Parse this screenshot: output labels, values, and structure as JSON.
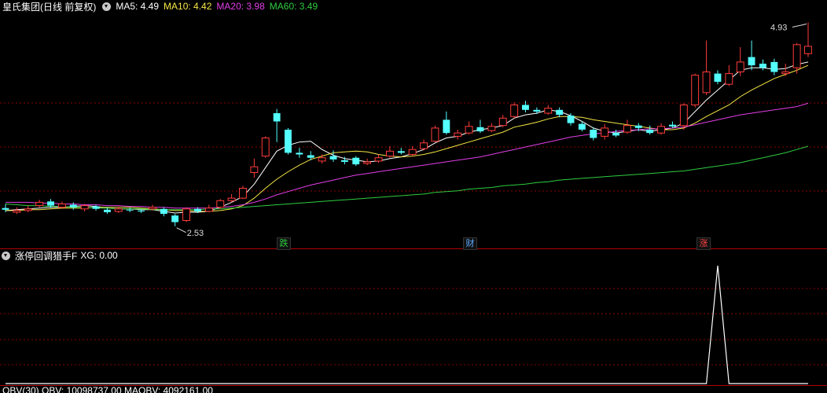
{
  "main_header": {
    "title": "皇氏集团(日线 前复权)",
    "ma5": "MA5: 4.49",
    "ma10": "MA10: 4.42",
    "ma20": "MA20: 3.98",
    "ma60": "MA60: 3.49",
    "colors": {
      "title": "#ffffff",
      "ma5": "#ffffff",
      "ma10": "#f5e645",
      "ma20": "#e23ee8",
      "ma60": "#2ecc40"
    }
  },
  "sub_header": {
    "title": "涨停回调猎手F",
    "xg": "XG: 0.00"
  },
  "bottom_header": {
    "text": "OBV(30)  OBV: 10098737.00  MAOBV: 4092161.00"
  },
  "markers": {
    "high_label": "4.93",
    "low_label": "2.53",
    "tags": [
      {
        "text": "跌",
        "color": "#2ecc40"
      },
      {
        "text": "财",
        "color": "#5aa9ff"
      },
      {
        "text": "涨",
        "color": "#ff4444"
      }
    ]
  },
  "chart_data": {
    "type": "candlestick",
    "ylim": [
      2.3,
      5.1
    ],
    "up_color": "#ff3b3b",
    "down_color": "#54ffff",
    "candles": [
      [
        2.75,
        2.73,
        2.8,
        2.7
      ],
      [
        2.7,
        2.72,
        2.76,
        2.68
      ],
      [
        2.72,
        2.74,
        2.78,
        2.7
      ],
      [
        2.78,
        2.82,
        2.85,
        2.76
      ],
      [
        2.83,
        2.78,
        2.86,
        2.75
      ],
      [
        2.76,
        2.8,
        2.83,
        2.74
      ],
      [
        2.79,
        2.76,
        2.82,
        2.73
      ],
      [
        2.74,
        2.78,
        2.8,
        2.71
      ],
      [
        2.77,
        2.74,
        2.79,
        2.72
      ],
      [
        2.73,
        2.7,
        2.76,
        2.68
      ],
      [
        2.71,
        2.74,
        2.77,
        2.69
      ],
      [
        2.73,
        2.72,
        2.76,
        2.7
      ],
      [
        2.72,
        2.71,
        2.74,
        2.69
      ],
      [
        2.74,
        2.76,
        2.79,
        2.72
      ],
      [
        2.74,
        2.68,
        2.76,
        2.65
      ],
      [
        2.66,
        2.58,
        2.68,
        2.53
      ],
      [
        2.6,
        2.74,
        2.76,
        2.58
      ],
      [
        2.74,
        2.71,
        2.76,
        2.69
      ],
      [
        2.71,
        2.75,
        2.79,
        2.7
      ],
      [
        2.76,
        2.84,
        2.86,
        2.74
      ],
      [
        2.84,
        2.87,
        2.92,
        2.82
      ],
      [
        2.87,
        2.99,
        3.02,
        2.86
      ],
      [
        3.18,
        3.25,
        3.35,
        3.12
      ],
      [
        3.38,
        3.6,
        3.62,
        3.36
      ],
      [
        3.9,
        3.8,
        3.95,
        3.55
      ],
      [
        3.7,
        3.42,
        3.72,
        3.4
      ],
      [
        3.42,
        3.4,
        3.48,
        3.36
      ],
      [
        3.39,
        3.36,
        3.44,
        3.33
      ],
      [
        3.32,
        3.36,
        3.4,
        3.29
      ],
      [
        3.38,
        3.34,
        3.45,
        3.31
      ],
      [
        3.33,
        3.31,
        3.37,
        3.28
      ],
      [
        3.36,
        3.28,
        3.38,
        3.26
      ],
      [
        3.29,
        3.31,
        3.35,
        3.27
      ],
      [
        3.32,
        3.36,
        3.4,
        3.3
      ],
      [
        3.38,
        3.44,
        3.5,
        3.36
      ],
      [
        3.44,
        3.42,
        3.48,
        3.4
      ],
      [
        3.4,
        3.46,
        3.5,
        3.38
      ],
      [
        3.47,
        3.54,
        3.58,
        3.45
      ],
      [
        3.56,
        3.72,
        3.75,
        3.55
      ],
      [
        3.82,
        3.66,
        3.92,
        3.64
      ],
      [
        3.62,
        3.66,
        3.7,
        3.58
      ],
      [
        3.66,
        3.74,
        3.8,
        3.64
      ],
      [
        3.73,
        3.68,
        3.82,
        3.66
      ],
      [
        3.69,
        3.74,
        3.78,
        3.67
      ],
      [
        3.75,
        3.84,
        3.88,
        3.73
      ],
      [
        3.86,
        4.0,
        4.03,
        3.84
      ],
      [
        4.0,
        3.94,
        4.05,
        3.91
      ],
      [
        3.94,
        3.92,
        3.97,
        3.89
      ],
      [
        3.9,
        3.96,
        4.0,
        3.88
      ],
      [
        3.94,
        3.88,
        3.97,
        3.85
      ],
      [
        3.87,
        3.78,
        3.9,
        3.75
      ],
      [
        3.77,
        3.7,
        3.8,
        3.68
      ],
      [
        3.7,
        3.6,
        3.73,
        3.57
      ],
      [
        3.62,
        3.72,
        3.77,
        3.58
      ],
      [
        3.66,
        3.63,
        3.7,
        3.61
      ],
      [
        3.67,
        3.75,
        3.82,
        3.65
      ],
      [
        3.75,
        3.72,
        3.78,
        3.68
      ],
      [
        3.7,
        3.66,
        3.75,
        3.64
      ],
      [
        3.66,
        3.74,
        3.78,
        3.64
      ],
      [
        3.76,
        3.74,
        3.8,
        3.72
      ],
      [
        3.75,
        4.0,
        4.02,
        3.7
      ],
      [
        4.0,
        4.36,
        4.38,
        3.97
      ],
      [
        4.15,
        4.4,
        4.78,
        4.12
      ],
      [
        4.38,
        4.28,
        4.42,
        4.25
      ],
      [
        4.25,
        4.38,
        4.48,
        4.23
      ],
      [
        4.4,
        4.52,
        4.7,
        4.35
      ],
      [
        4.58,
        4.48,
        4.78,
        4.42
      ],
      [
        4.5,
        4.45,
        4.55,
        4.42
      ],
      [
        4.52,
        4.4,
        4.56,
        4.36
      ],
      [
        4.38,
        4.4,
        4.5,
        4.35
      ],
      [
        4.45,
        4.73,
        4.75,
        4.38
      ],
      [
        4.62,
        4.71,
        5.0,
        4.58
      ]
    ],
    "ma": [
      {
        "name": "MA5",
        "color": "#ffffff",
        "values": [
          2.72,
          2.73,
          2.74,
          2.75,
          2.76,
          2.76,
          2.77,
          2.78,
          2.77,
          2.75,
          2.74,
          2.74,
          2.73,
          2.73,
          2.71,
          2.69,
          2.7,
          2.7,
          2.71,
          2.76,
          2.82,
          2.89,
          3.04,
          3.24,
          3.44,
          3.51,
          3.55,
          3.56,
          3.46,
          3.39,
          3.35,
          3.33,
          3.31,
          3.32,
          3.35,
          3.37,
          3.41,
          3.46,
          3.54,
          3.6,
          3.62,
          3.67,
          3.7,
          3.72,
          3.75,
          3.84,
          3.88,
          3.9,
          3.94,
          3.92,
          3.87,
          3.8,
          3.72,
          3.68,
          3.66,
          3.68,
          3.7,
          3.68,
          3.7,
          3.72,
          3.78,
          3.92,
          4.06,
          4.18,
          4.3,
          4.42,
          4.45,
          4.45,
          4.43,
          4.44,
          4.49,
          4.52
        ]
      },
      {
        "name": "MA10",
        "color": "#f5e645",
        "values": [
          2.72,
          2.72,
          2.73,
          2.73,
          2.74,
          2.75,
          2.75,
          2.75,
          2.76,
          2.76,
          2.76,
          2.76,
          2.75,
          2.74,
          2.73,
          2.72,
          2.72,
          2.71,
          2.71,
          2.72,
          2.74,
          2.78,
          2.87,
          2.99,
          3.1,
          3.19,
          3.27,
          3.34,
          3.38,
          3.42,
          3.43,
          3.44,
          3.43,
          3.4,
          3.38,
          3.37,
          3.38,
          3.4,
          3.43,
          3.47,
          3.51,
          3.55,
          3.59,
          3.63,
          3.67,
          3.73,
          3.76,
          3.79,
          3.83,
          3.86,
          3.86,
          3.85,
          3.82,
          3.8,
          3.78,
          3.76,
          3.74,
          3.72,
          3.7,
          3.7,
          3.72,
          3.78,
          3.86,
          3.93,
          4.0,
          4.1,
          4.18,
          4.25,
          4.32,
          4.37,
          4.42,
          4.48
        ]
      },
      {
        "name": "MA20",
        "color": "#e23ee8",
        "values": [
          2.82,
          2.82,
          2.82,
          2.81,
          2.81,
          2.8,
          2.8,
          2.79,
          2.79,
          2.78,
          2.78,
          2.77,
          2.77,
          2.76,
          2.76,
          2.75,
          2.75,
          2.75,
          2.75,
          2.76,
          2.77,
          2.79,
          2.82,
          2.86,
          2.91,
          2.95,
          2.99,
          3.03,
          3.06,
          3.09,
          3.12,
          3.15,
          3.17,
          3.19,
          3.21,
          3.23,
          3.25,
          3.27,
          3.29,
          3.31,
          3.33,
          3.35,
          3.37,
          3.4,
          3.43,
          3.46,
          3.49,
          3.52,
          3.55,
          3.58,
          3.61,
          3.63,
          3.65,
          3.66,
          3.68,
          3.69,
          3.7,
          3.71,
          3.71,
          3.72,
          3.73,
          3.76,
          3.79,
          3.82,
          3.85,
          3.88,
          3.9,
          3.92,
          3.94,
          3.96,
          3.98,
          4.02
        ]
      },
      {
        "name": "MA60",
        "color": "#2ecc40",
        "values": [
          2.8,
          2.79,
          2.78,
          2.78,
          2.77,
          2.77,
          2.76,
          2.76,
          2.75,
          2.75,
          2.74,
          2.74,
          2.74,
          2.73,
          2.73,
          2.73,
          2.73,
          2.73,
          2.74,
          2.74,
          2.75,
          2.76,
          2.77,
          2.78,
          2.79,
          2.8,
          2.81,
          2.82,
          2.83,
          2.84,
          2.85,
          2.86,
          2.87,
          2.88,
          2.89,
          2.9,
          2.91,
          2.92,
          2.94,
          2.95,
          2.96,
          2.98,
          2.99,
          3.0,
          3.02,
          3.03,
          3.04,
          3.06,
          3.07,
          3.09,
          3.1,
          3.11,
          3.12,
          3.13,
          3.14,
          3.15,
          3.16,
          3.17,
          3.18,
          3.19,
          3.2,
          3.22,
          3.24,
          3.26,
          3.28,
          3.3,
          3.33,
          3.36,
          3.39,
          3.42,
          3.46,
          3.5
        ]
      }
    ],
    "xg_signal": {
      "ylim": [
        0,
        1
      ],
      "values": [
        0,
        0,
        0,
        0,
        0,
        0,
        0,
        0,
        0,
        0,
        0,
        0,
        0,
        0,
        0,
        0,
        0,
        0,
        0,
        0,
        0,
        0,
        0,
        0,
        0,
        0,
        0,
        0,
        0,
        0,
        0,
        0,
        0,
        0,
        0,
        0,
        0,
        0,
        0,
        0,
        0,
        0,
        0,
        0,
        0,
        0,
        0,
        0,
        0,
        0,
        0,
        0,
        0,
        0,
        0,
        0,
        0,
        0,
        0,
        0,
        0,
        0,
        0,
        1,
        0,
        0,
        0,
        0,
        0,
        0,
        0,
        0
      ]
    }
  }
}
